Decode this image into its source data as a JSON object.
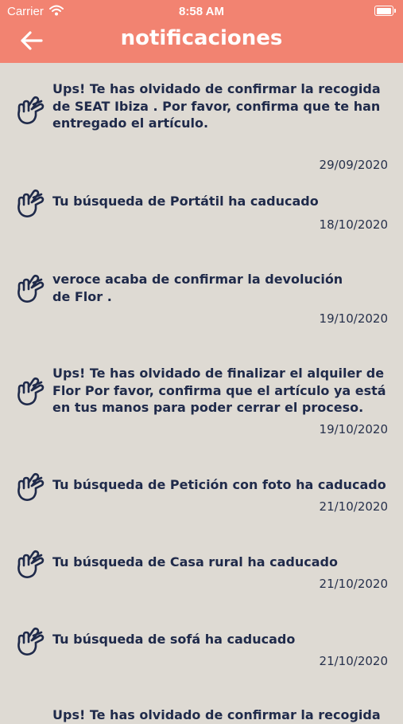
{
  "status_bar": {
    "carrier": "Carrier",
    "time": "8:58 AM"
  },
  "header": {
    "title": "notificaciones",
    "back_icon": "arrow-left-icon",
    "color": "#f28371"
  },
  "notification_icon": "hand-pointing-icon",
  "notifications": [
    {
      "message": "Ups! Te has olvidado de confirmar la recogida\nde  SEAT Ibiza  . Por favor, confirma que te han\nentregado el artículo.",
      "date": "29/09/2020"
    },
    {
      "message": "Tu búsqueda de Portátil ha caducado",
      "date": "18/10/2020"
    },
    {
      "message": "veroce acaba de confirmar la devolución\nde Flor .",
      "date": "19/10/2020"
    },
    {
      "message": "Ups! Te has olvidado de finalizar el alquiler de\nFlor Por favor, confirma que el artículo ya está\nen tus manos para poder cerrar el proceso.",
      "date": "19/10/2020"
    },
    {
      "message": "Tu búsqueda de Petición con foto ha caducado",
      "date": "21/10/2020"
    },
    {
      "message": "Tu búsqueda de Casa rural ha caducado",
      "date": "21/10/2020"
    },
    {
      "message": "Tu búsqueda de sofá ha caducado",
      "date": "21/10/2020"
    },
    {
      "message": "Ups! Te has olvidado de confirmar la recogida",
      "date": ""
    }
  ]
}
